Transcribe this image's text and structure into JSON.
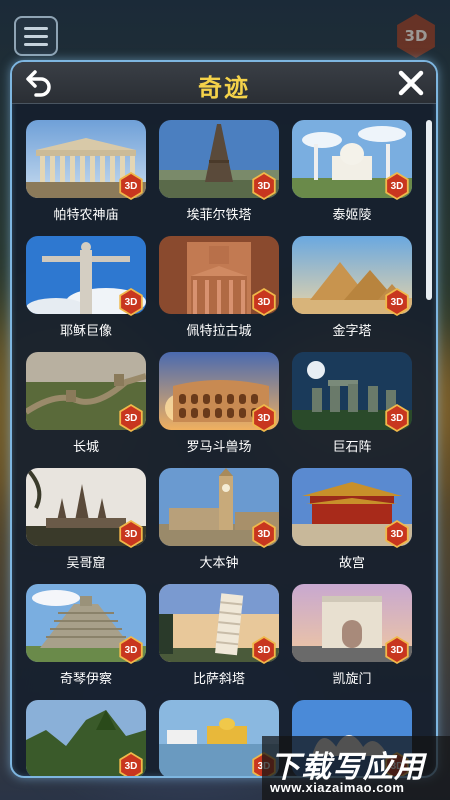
{
  "header": {
    "title": "奇迹",
    "back_icon": "back-arrow-icon",
    "close_icon": "close-icon"
  },
  "topbar": {
    "menu_icon": "hamburger-menu-icon",
    "mode_badge": "3D"
  },
  "badge_label": "3D",
  "wonders": [
    {
      "name": "帕特农神庙",
      "scene": "parthenon"
    },
    {
      "name": "埃菲尔铁塔",
      "scene": "eiffel"
    },
    {
      "name": "泰姬陵",
      "scene": "tajmahal"
    },
    {
      "name": "耶稣巨像",
      "scene": "christ"
    },
    {
      "name": "佩特拉古城",
      "scene": "petra"
    },
    {
      "name": "金字塔",
      "scene": "pyramids"
    },
    {
      "name": "长城",
      "scene": "greatwall"
    },
    {
      "name": "罗马斗兽场",
      "scene": "colosseum"
    },
    {
      "name": "巨石阵",
      "scene": "stonehenge"
    },
    {
      "name": "吴哥窟",
      "scene": "angkor"
    },
    {
      "name": "大本钟",
      "scene": "bigben"
    },
    {
      "name": "故宫",
      "scene": "forbidden"
    },
    {
      "name": "奇琴伊察",
      "scene": "chichen"
    },
    {
      "name": "比萨斜塔",
      "scene": "pisa"
    },
    {
      "name": "凯旋门",
      "scene": "arc"
    },
    {
      "name": "",
      "scene": "machupicchu"
    },
    {
      "name": "",
      "scene": "goldentemple"
    },
    {
      "name": "",
      "scene": "opera"
    }
  ],
  "watermark": {
    "text": "下载写应用",
    "url": "www.xiazaimao.com"
  },
  "colors": {
    "title": "#f4d24a",
    "panel_border": "#7eb6e0",
    "badge": "#c8361f",
    "badge_rim": "#f0b84a"
  }
}
